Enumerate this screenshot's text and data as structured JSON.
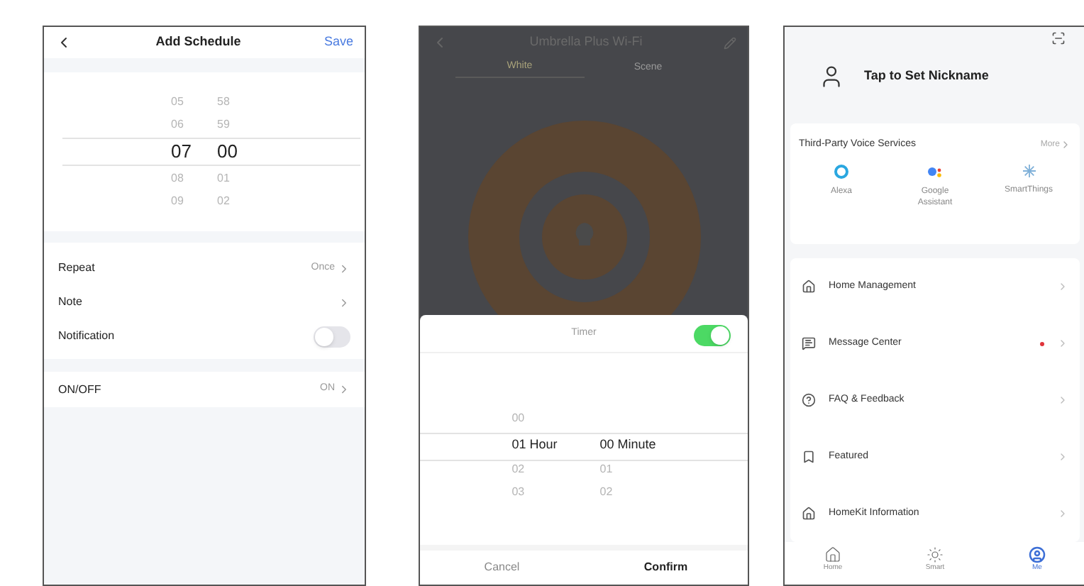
{
  "schedule": {
    "title": "Add Schedule",
    "action": "Save",
    "hours": [
      {
        "label": "05",
        "selected": false
      },
      {
        "label": "06",
        "selected": false
      },
      {
        "label": "07",
        "selected": true
      },
      {
        "label": "08",
        "selected": false
      },
      {
        "label": "09",
        "selected": false
      }
    ],
    "minutes": [
      {
        "label": "58",
        "selected": false
      },
      {
        "label": "59",
        "selected": false
      },
      {
        "label": "00",
        "selected": true
      },
      {
        "label": "01",
        "selected": false
      },
      {
        "label": "02",
        "selected": false
      }
    ],
    "settings": [
      {
        "kind": "link",
        "label": "Repeat",
        "value": "Once"
      },
      {
        "kind": "link",
        "label": "Note"
      },
      {
        "kind": "toggle",
        "label": "Notification",
        "on": false
      }
    ],
    "power": {
      "label": "ON/OFF",
      "value": "ON"
    }
  },
  "device": {
    "title": "Umbrella Plus Wi-Fi",
    "tabs": [
      {
        "label": "White",
        "selected": true
      },
      {
        "label": "Scene",
        "selected": false
      }
    ],
    "timer": {
      "title": "Timer",
      "on": true,
      "hours": [
        {
          "label": "00",
          "selected": false
        },
        {
          "label": "01 Hour",
          "selected": true
        },
        {
          "label": "02",
          "selected": false
        },
        {
          "label": "03",
          "selected": false
        }
      ],
      "minutes": [
        {
          "label": "00 Minute",
          "selected": true
        },
        {
          "label": "01",
          "selected": false
        },
        {
          "label": "02",
          "selected": false
        }
      ],
      "cancel": "Cancel",
      "confirm": "Confirm"
    }
  },
  "profile": {
    "nickname": "Tap to Set Nickname",
    "voice": {
      "title": "Third-Party Voice Services",
      "more": "More",
      "services": [
        {
          "kind": "alexa",
          "label": "Alexa"
        },
        {
          "kind": "google",
          "label": "Google Assistant"
        },
        {
          "kind": "smartthings",
          "label": "SmartThings"
        }
      ]
    },
    "menu": [
      {
        "kind": "home",
        "label": "Home Management",
        "unread": false
      },
      {
        "kind": "message",
        "label": "Message Center",
        "unread": true
      },
      {
        "kind": "faq",
        "label": "FAQ & Feedback",
        "unread": false
      },
      {
        "kind": "featured",
        "label": "Featured",
        "unread": false
      },
      {
        "kind": "homekit",
        "label": "HomeKit Information",
        "unread": false
      }
    ],
    "nav": [
      {
        "kind": "home",
        "label": "Home",
        "selected": false
      },
      {
        "kind": "smart",
        "label": "Smart",
        "selected": false
      },
      {
        "kind": "me",
        "label": "Me",
        "selected": true
      }
    ]
  }
}
